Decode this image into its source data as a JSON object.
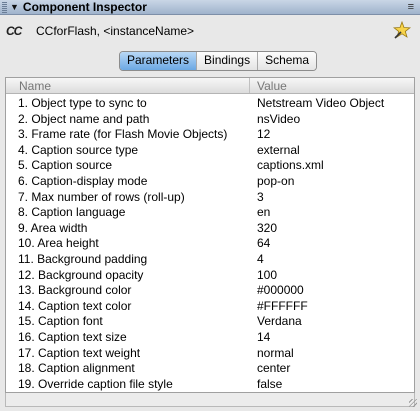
{
  "panel": {
    "title": "Component Inspector",
    "collapse_glyph": "▼",
    "menu_glyph": "≡"
  },
  "component": {
    "icon_text": "CC",
    "label": "CCforFlash, <instanceName>",
    "help_icon": "star-wand-icon"
  },
  "tabs": [
    {
      "label": "Parameters",
      "active": true
    },
    {
      "label": "Bindings",
      "active": false
    },
    {
      "label": "Schema",
      "active": false
    }
  ],
  "table": {
    "headers": {
      "name": "Name",
      "value": "Value"
    },
    "rows": [
      {
        "name": "1.  Object type to sync to",
        "value": "Netstream Video Object"
      },
      {
        "name": "2.  Object name and path",
        "value": "nsVideo"
      },
      {
        "name": "3.  Frame rate (for Flash Movie Objects)",
        "value": "12"
      },
      {
        "name": "4.  Caption source type",
        "value": "external"
      },
      {
        "name": "5.  Caption source",
        "value": "captions.xml"
      },
      {
        "name": "6.  Caption-display mode",
        "value": "pop-on"
      },
      {
        "name": "7.  Max number of rows (roll-up)",
        "value": "3"
      },
      {
        "name": "8.  Caption language",
        "value": "en"
      },
      {
        "name": "9.  Area width",
        "value": "320"
      },
      {
        "name": "10. Area height",
        "value": "64"
      },
      {
        "name": "11. Background padding",
        "value": "4"
      },
      {
        "name": "12. Background opacity",
        "value": "100"
      },
      {
        "name": "13. Background color",
        "value": "#000000"
      },
      {
        "name": "14. Caption text color",
        "value": "#FFFFFF"
      },
      {
        "name": "15. Caption font",
        "value": "Verdana"
      },
      {
        "name": "16. Caption text size",
        "value": "14"
      },
      {
        "name": "17. Caption text weight",
        "value": "normal"
      },
      {
        "name": "18. Caption alignment",
        "value": "center"
      },
      {
        "name": "19. Override caption file style",
        "value": "false"
      }
    ]
  }
}
